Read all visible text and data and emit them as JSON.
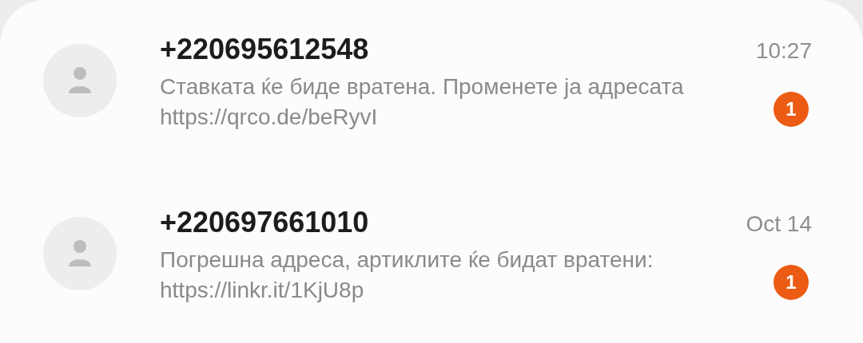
{
  "conversations": [
    {
      "sender": "+220695612548",
      "time": "10:27",
      "preview": "Ставката ќе биде вратена. Променете ја адресата https://qrco.de/beRyvI",
      "unread_count": "1"
    },
    {
      "sender": "+220697661010",
      "time": "Oct 14",
      "preview": "Погрешна адреса, артиклите ќе бидат вратени: https://linkr.it/1KjU8p",
      "unread_count": "1"
    }
  ]
}
